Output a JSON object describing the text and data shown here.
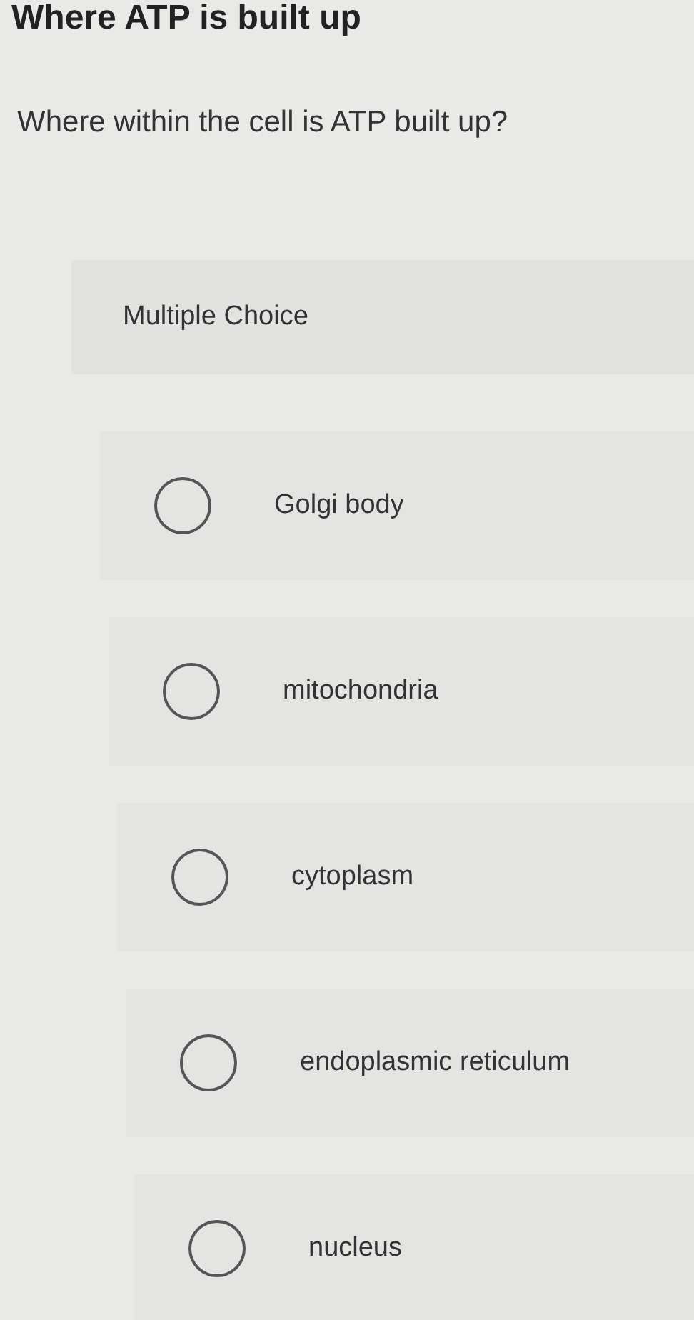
{
  "page_title": "Where ATP is built up",
  "question": "Where within the cell is ATP built up?",
  "question_type": "Multiple Choice",
  "options": [
    {
      "label": "Golgi body",
      "selected": false
    },
    {
      "label": "mitochondria",
      "selected": false
    },
    {
      "label": "cytoplasm",
      "selected": false
    },
    {
      "label": "endoplasmic reticulum",
      "selected": false
    },
    {
      "label": "nucleus",
      "selected": false
    }
  ]
}
